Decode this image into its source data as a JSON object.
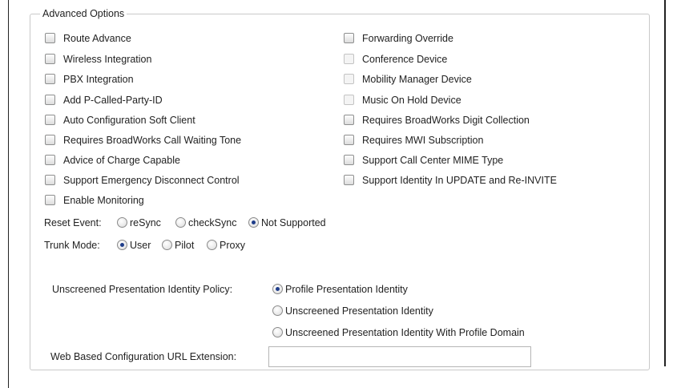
{
  "advanced_options": {
    "legend": "Advanced Options",
    "left_checkboxes": [
      {
        "label": "Route Advance",
        "checked": false,
        "enabled": true
      },
      {
        "label": "Wireless Integration",
        "checked": false,
        "enabled": true
      },
      {
        "label": "PBX Integration",
        "checked": false,
        "enabled": true
      },
      {
        "label": "Add P-Called-Party-ID",
        "checked": false,
        "enabled": true
      },
      {
        "label": "Auto Configuration Soft Client",
        "checked": false,
        "enabled": true
      },
      {
        "label": "Requires BroadWorks Call Waiting Tone",
        "checked": false,
        "enabled": true
      },
      {
        "label": "Advice of Charge Capable",
        "checked": false,
        "enabled": true
      },
      {
        "label": "Support Emergency Disconnect Control",
        "checked": false,
        "enabled": true
      },
      {
        "label": "Enable Monitoring",
        "checked": false,
        "enabled": true
      }
    ],
    "right_checkboxes": [
      {
        "label": "Forwarding Override",
        "checked": false,
        "enabled": true
      },
      {
        "label": "Conference Device",
        "checked": false,
        "enabled": false
      },
      {
        "label": "Mobility Manager Device",
        "checked": false,
        "enabled": false
      },
      {
        "label": "Music On Hold Device",
        "checked": false,
        "enabled": false
      },
      {
        "label": "Requires BroadWorks Digit Collection",
        "checked": false,
        "enabled": true
      },
      {
        "label": "Requires MWI Subscription",
        "checked": false,
        "enabled": true
      },
      {
        "label": "Support Call Center MIME Type",
        "checked": false,
        "enabled": true
      },
      {
        "label": "Support Identity In UPDATE and Re-INVITE",
        "checked": false,
        "enabled": true
      }
    ],
    "reset_event": {
      "label": "Reset Event:",
      "options": [
        "reSync",
        "checkSync",
        "Not Supported"
      ],
      "selected": "Not Supported"
    },
    "trunk_mode": {
      "label": "Trunk Mode:",
      "options": [
        "User",
        "Pilot",
        "Proxy"
      ],
      "selected": "User"
    },
    "unscreened_policy": {
      "label": "Unscreened Presentation Identity Policy:",
      "options": [
        "Profile Presentation Identity",
        "Unscreened Presentation Identity",
        "Unscreened Presentation Identity With Profile Domain"
      ],
      "selected": "Profile Presentation Identity"
    },
    "web_config_url": {
      "label": "Web Based Configuration URL Extension:",
      "value": ""
    }
  }
}
